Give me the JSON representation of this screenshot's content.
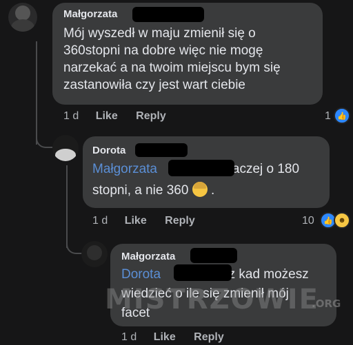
{
  "comments": [
    {
      "author": "Małgorzata",
      "text_lines": [
        "Mój wyszedł w maju zmienił się o",
        "360stopni na dobre więc nie mogę",
        "narzekać a na twoim miejscu bym się",
        "zastanowiła czy  jest wart ciebie"
      ],
      "meta": {
        "time": "1 d",
        "like": "Like",
        "reply": "Reply"
      },
      "reactions": {
        "count": "1",
        "icons": [
          "like-icon"
        ]
      }
    },
    {
      "author": "Dorota",
      "mention": "Małgorzata",
      "text_line1_rest": "raczej o 180",
      "text_line2": "stopni, a nie 360",
      "text_line2_end": ".",
      "meta": {
        "time": "1 d",
        "like": "Like",
        "reply": "Reply"
      },
      "reactions": {
        "count": "10",
        "icons": [
          "like-icon",
          "haha-icon"
        ]
      }
    },
    {
      "author": "Małgorzata",
      "mention": "Dorota",
      "text_line1_rest": "z kad możesz",
      "text_line2": "wiedzieć o ile się zmienił mój",
      "text_line3": "facet",
      "meta": {
        "time": "1 d",
        "like": "Like",
        "reply": "Reply"
      }
    }
  ],
  "watermark": {
    "text": "MISTRZOWIE",
    "suffix": ".ORG"
  },
  "colors": {
    "background": "#161617",
    "bubble": "#3a3b3c",
    "mention": "#5b8fd6",
    "like_badge": "#2d88ff"
  }
}
